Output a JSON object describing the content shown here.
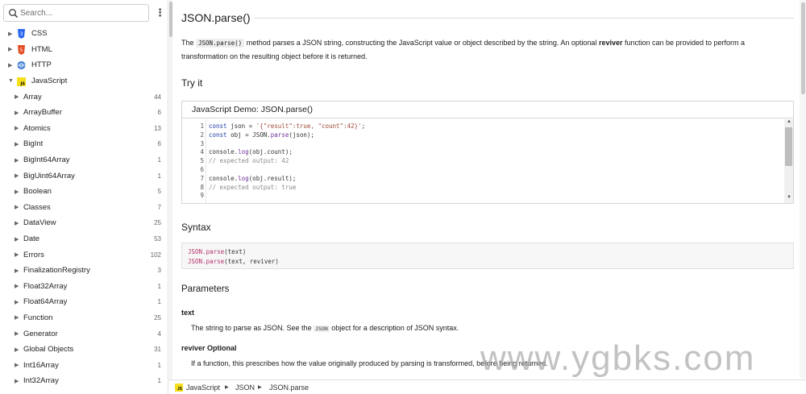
{
  "sidebar": {
    "search_placeholder": "Search...",
    "menu_glyph": "⋮",
    "top_items": [
      {
        "label": "CSS",
        "icon": "css-shield-icon",
        "color": "#2965f1"
      },
      {
        "label": "HTML",
        "icon": "html-shield-icon",
        "color": "#e44d26"
      },
      {
        "label": "HTTP",
        "icon": "http-globe-icon",
        "color": "#3a7bd5"
      },
      {
        "label": "JavaScript",
        "icon": "js-square-icon",
        "color": "#f7df1e"
      }
    ],
    "sub_items": [
      {
        "label": "Array",
        "count": "44"
      },
      {
        "label": "ArrayBuffer",
        "count": "6"
      },
      {
        "label": "Atomics",
        "count": "13"
      },
      {
        "label": "BigInt",
        "count": "6"
      },
      {
        "label": "BigInt64Array",
        "count": "1"
      },
      {
        "label": "BigUint64Array",
        "count": "1"
      },
      {
        "label": "Boolean",
        "count": "5"
      },
      {
        "label": "Classes",
        "count": "7"
      },
      {
        "label": "DataView",
        "count": "25"
      },
      {
        "label": "Date",
        "count": "53"
      },
      {
        "label": "Errors",
        "count": "102"
      },
      {
        "label": "FinalizationRegistry",
        "count": "3"
      },
      {
        "label": "Float32Array",
        "count": "1"
      },
      {
        "label": "Float64Array",
        "count": "1"
      },
      {
        "label": "Function",
        "count": "25"
      },
      {
        "label": "Generator",
        "count": "4"
      },
      {
        "label": "Global Objects",
        "count": "31"
      },
      {
        "label": "Int16Array",
        "count": "1"
      },
      {
        "label": "Int32Array",
        "count": "1"
      }
    ]
  },
  "main": {
    "title": "JSON.parse()",
    "intro_pre": "The ",
    "intro_code": "JSON.parse()",
    "intro_mid": " method parses a JSON string, constructing the JavaScript value or object described by the string. An optional ",
    "intro_bold": "reviver",
    "intro_post": " function can be provided to perform a transformation on the resulting object before it is returned.",
    "try_it_heading": "Try it",
    "demo_title": "JavaScript Demo: JSON.parse()",
    "code_lines": [
      {
        "n": "1",
        "text": "const json = '{\"result\":true, \"count\":42}';"
      },
      {
        "n": "2",
        "text": "const obj = JSON.parse(json);"
      },
      {
        "n": "3",
        "text": ""
      },
      {
        "n": "4",
        "text": "console.log(obj.count);"
      },
      {
        "n": "5",
        "text": "// expected output: 42"
      },
      {
        "n": "6",
        "text": ""
      },
      {
        "n": "7",
        "text": "console.log(obj.result);"
      },
      {
        "n": "8",
        "text": "// expected output: true"
      },
      {
        "n": "9",
        "text": ""
      }
    ],
    "syntax_heading": "Syntax",
    "syntax_lines": [
      {
        "fn": "JSON.parse",
        "args": "(text)"
      },
      {
        "fn": "JSON.parse",
        "args": "(text, reviver)"
      }
    ],
    "parameters_heading": "Parameters",
    "param1_name": "text",
    "param1_desc_pre": "The string to parse as JSON. See the ",
    "param1_desc_code": "JSON",
    "param1_desc_post": " object for a description of JSON syntax.",
    "param2_name": "reviver Optional",
    "param2_desc": "If a function, this prescribes how the value originally produced by parsing is transformed, before being returned."
  },
  "breadcrumb": [
    "JavaScript",
    "JSON",
    "JSON.parse"
  ],
  "watermark": "www.ygbks.com"
}
